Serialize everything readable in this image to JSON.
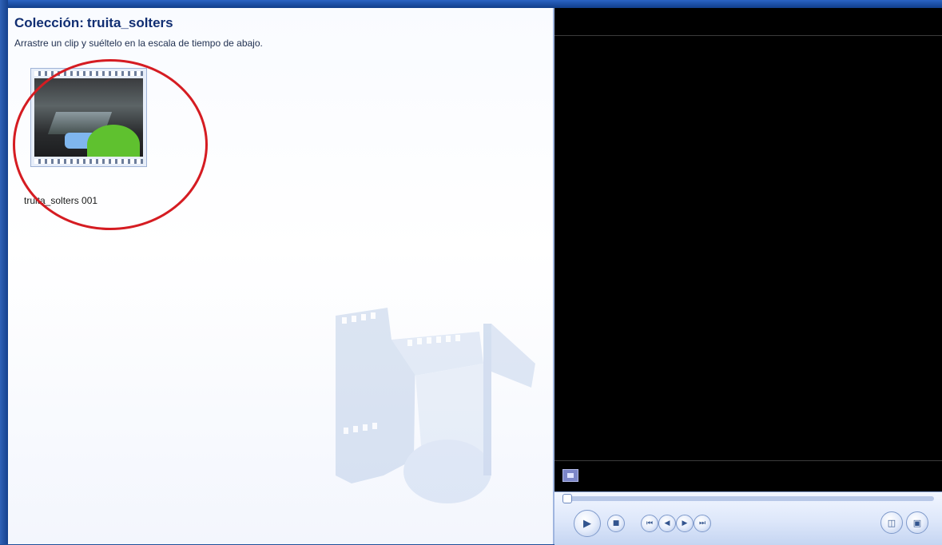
{
  "collection": {
    "title_prefix": "Colección:",
    "title_name": "truita_solters",
    "instruction": "Arrastre un clip y suéltelo en la escala de tiempo de abajo."
  },
  "clips": [
    {
      "name": "truita_solters 001",
      "highlighted": true
    }
  ],
  "preview": {
    "controls": {
      "play_icon": "play-icon",
      "stop_icon": "stop-icon",
      "rewind_icon": "rewind-icon",
      "prev_frame_icon": "previous-frame-icon",
      "next_frame_icon": "next-frame-icon",
      "forward_icon": "fast-forward-icon",
      "split_icon": "split-clip-icon",
      "snapshot_icon": "take-picture-icon",
      "fullscreen_icon": "fullscreen-icon"
    },
    "seek_position": 0
  },
  "colors": {
    "frame": "#1f4f9a",
    "title": "#112e72",
    "highlight": "#d51c22",
    "preview_bg": "#000000"
  }
}
